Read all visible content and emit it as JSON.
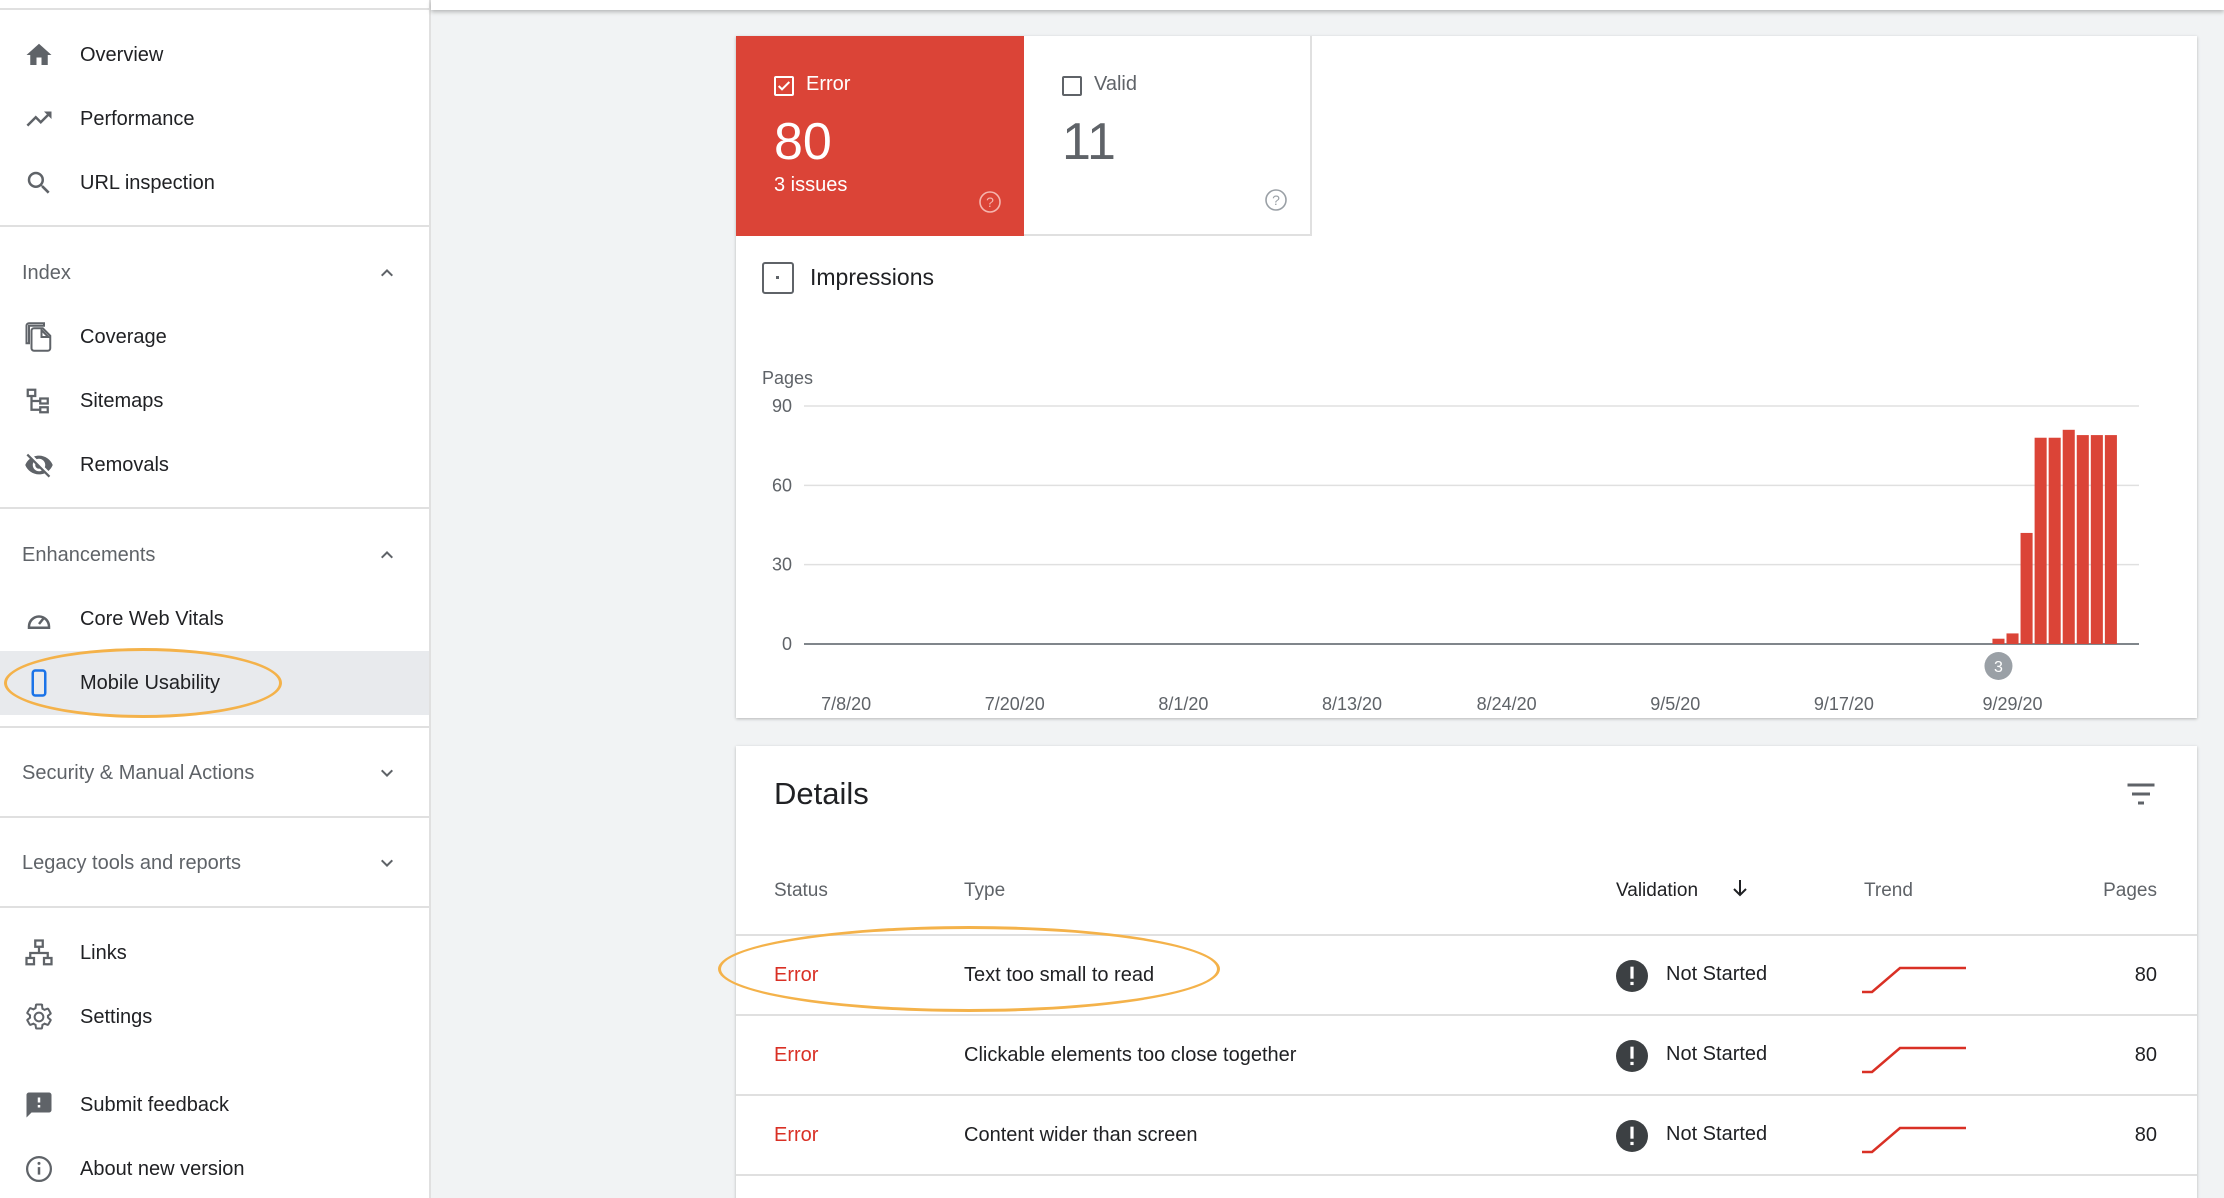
{
  "sidebar": {
    "top_items": [
      {
        "label": "Overview",
        "icon": "home-icon"
      },
      {
        "label": "Performance",
        "icon": "trending-up-icon"
      },
      {
        "label": "URL inspection",
        "icon": "search-icon"
      }
    ],
    "index": {
      "title": "Index",
      "items": [
        {
          "label": "Coverage",
          "icon": "file-copy-icon"
        },
        {
          "label": "Sitemaps",
          "icon": "sitemap-icon"
        },
        {
          "label": "Removals",
          "icon": "eye-off-icon"
        }
      ]
    },
    "enhancements": {
      "title": "Enhancements",
      "items": [
        {
          "label": "Core Web Vitals",
          "icon": "speedometer-icon"
        },
        {
          "label": "Mobile Usability",
          "icon": "smartphone-icon"
        }
      ]
    },
    "security": {
      "title": "Security & Manual Actions"
    },
    "legacy": {
      "title": "Legacy tools and reports"
    },
    "bottom_items": [
      {
        "label": "Links",
        "icon": "links-icon"
      },
      {
        "label": "Settings",
        "icon": "gear-icon"
      },
      {
        "label": "Submit feedback",
        "icon": "feedback-icon"
      },
      {
        "label": "About new version",
        "icon": "info-icon"
      }
    ]
  },
  "summary": {
    "error": {
      "label": "Error",
      "value": "80",
      "sub": "3 issues",
      "color": "#db4437"
    },
    "valid": {
      "label": "Valid",
      "value": "11"
    },
    "impressions_label": "Impressions"
  },
  "chart_data": {
    "type": "bar",
    "ylabel": "Pages",
    "ylim": [
      0,
      90
    ],
    "yticks": [
      0,
      30,
      60,
      90
    ],
    "xticks": [
      "7/8/20",
      "7/20/20",
      "8/1/20",
      "8/13/20",
      "8/24/20",
      "9/5/20",
      "9/17/20",
      "9/29/20"
    ],
    "x_start": "2020-07-05",
    "x_end": "2020-10-08",
    "series": [
      {
        "color": "#db4437",
        "x": [
          "2020-09-28",
          "2020-09-29",
          "2020-09-30",
          "2020-10-01",
          "2020-10-02",
          "2020-10-03",
          "2020-10-04",
          "2020-10-05",
          "2020-10-06"
        ],
        "values": [
          2,
          4,
          42,
          78,
          78,
          81,
          79,
          79,
          79
        ]
      }
    ],
    "annotations": [
      {
        "x": "2020-09-28",
        "label": "3"
      }
    ]
  },
  "details": {
    "title": "Details",
    "columns": {
      "status": "Status",
      "type": "Type",
      "validation": "Validation",
      "trend": "Trend",
      "pages": "Pages"
    },
    "rows": [
      {
        "status": "Error",
        "type": "Text too small to read",
        "validation": "Not Started",
        "pages": "80"
      },
      {
        "status": "Error",
        "type": "Clickable elements too close together",
        "validation": "Not Started",
        "pages": "80"
      },
      {
        "status": "Error",
        "type": "Content wider than screen",
        "validation": "Not Started",
        "pages": "80"
      }
    ]
  }
}
